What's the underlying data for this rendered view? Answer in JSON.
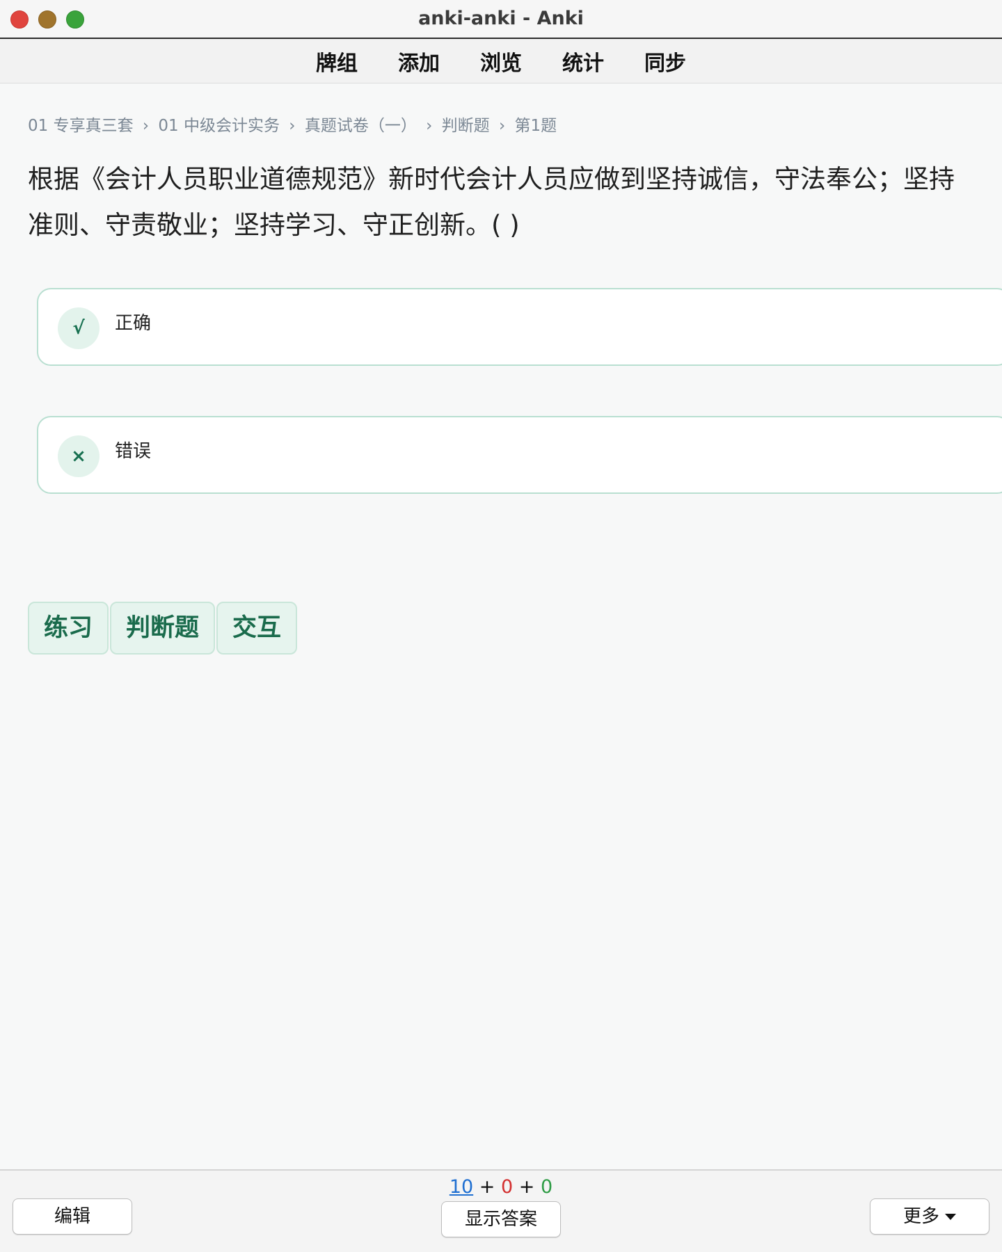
{
  "window": {
    "title": "anki-anki - Anki"
  },
  "toolbar": {
    "items": [
      "牌组",
      "添加",
      "浏览",
      "统计",
      "同步"
    ]
  },
  "breadcrumb": {
    "items": [
      "01 专享真三套",
      "01 中级会计实务",
      "真题试卷（一）",
      "判断题",
      "第1题"
    ],
    "separator": "›"
  },
  "question": {
    "text": "根据《会计人员职业道德规范》新时代会计人员应做到坚持诚信，守法奉公；坚持准则、守责敬业；坚持学习、守正创新。( )"
  },
  "options": [
    {
      "symbol": "√",
      "label": "正确"
    },
    {
      "symbol": "×",
      "label": "错误"
    }
  ],
  "tags": [
    "练习",
    "判断题",
    "交互"
  ],
  "bottom": {
    "edit_label": "编辑",
    "show_answer_label": "显示答案",
    "more_label": "更多",
    "counts": {
      "new": "10",
      "plus1": "+",
      "learn": "0",
      "plus2": "+",
      "review": "0"
    }
  },
  "colors": {
    "accent_green": "#1a6b4c",
    "option_border": "#b9dfd1",
    "count_new": "#1f6fd1",
    "count_learn": "#d32f2f",
    "count_review": "#2e9c45"
  },
  "icons": {
    "correct": "check-icon",
    "wrong": "cross-icon",
    "more_dropdown": "caret-down-icon"
  }
}
